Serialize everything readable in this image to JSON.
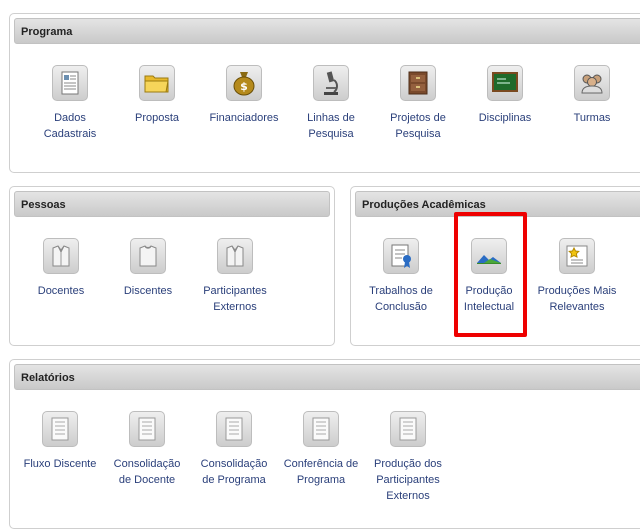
{
  "programa": {
    "title": "Programa",
    "items": [
      {
        "label": "Dados\nCadastrais",
        "icon": "document-form-icon"
      },
      {
        "label": "Proposta",
        "icon": "folder-icon"
      },
      {
        "label": "Financiadores",
        "icon": "money-bag-icon"
      },
      {
        "label": "Linhas de\nPesquisa",
        "icon": "microscope-icon"
      },
      {
        "label": "Projetos de\nPesquisa",
        "icon": "file-cabinet-icon"
      },
      {
        "label": "Disciplinas",
        "icon": "chalkboard-icon"
      },
      {
        "label": "Turmas",
        "icon": "group-icon"
      }
    ]
  },
  "pessoas": {
    "title": "Pessoas",
    "items": [
      {
        "label": "Docentes",
        "icon": "suit-icon"
      },
      {
        "label": "Discentes",
        "icon": "shirt-icon"
      },
      {
        "label": "Participantes\nExternos",
        "icon": "suit-icon"
      }
    ]
  },
  "producoes": {
    "title": "Produções Acadêmicas",
    "items": [
      {
        "label": "Trabalhos de\nConclusão",
        "icon": "thesis-icon"
      },
      {
        "label": "Produção\nIntelectual",
        "icon": "landscape-icon"
      },
      {
        "label": "Produções Mais\nRelevantes",
        "icon": "star-certificate-icon"
      }
    ]
  },
  "relatorios": {
    "title": "Relatórios",
    "items": [
      {
        "label": "Fluxo Discente",
        "icon": "report-icon"
      },
      {
        "label": "Consolidação\nde Docente",
        "icon": "report-icon"
      },
      {
        "label": "Consolidação\nde Programa",
        "icon": "report-icon"
      },
      {
        "label": "Conferência de\nPrograma",
        "icon": "report-icon"
      },
      {
        "label": "Produção dos\nParticipantes\nExternos",
        "icon": "report-icon"
      }
    ]
  },
  "highlight_color": "#ee0000",
  "link_color": "#2a3f7a"
}
